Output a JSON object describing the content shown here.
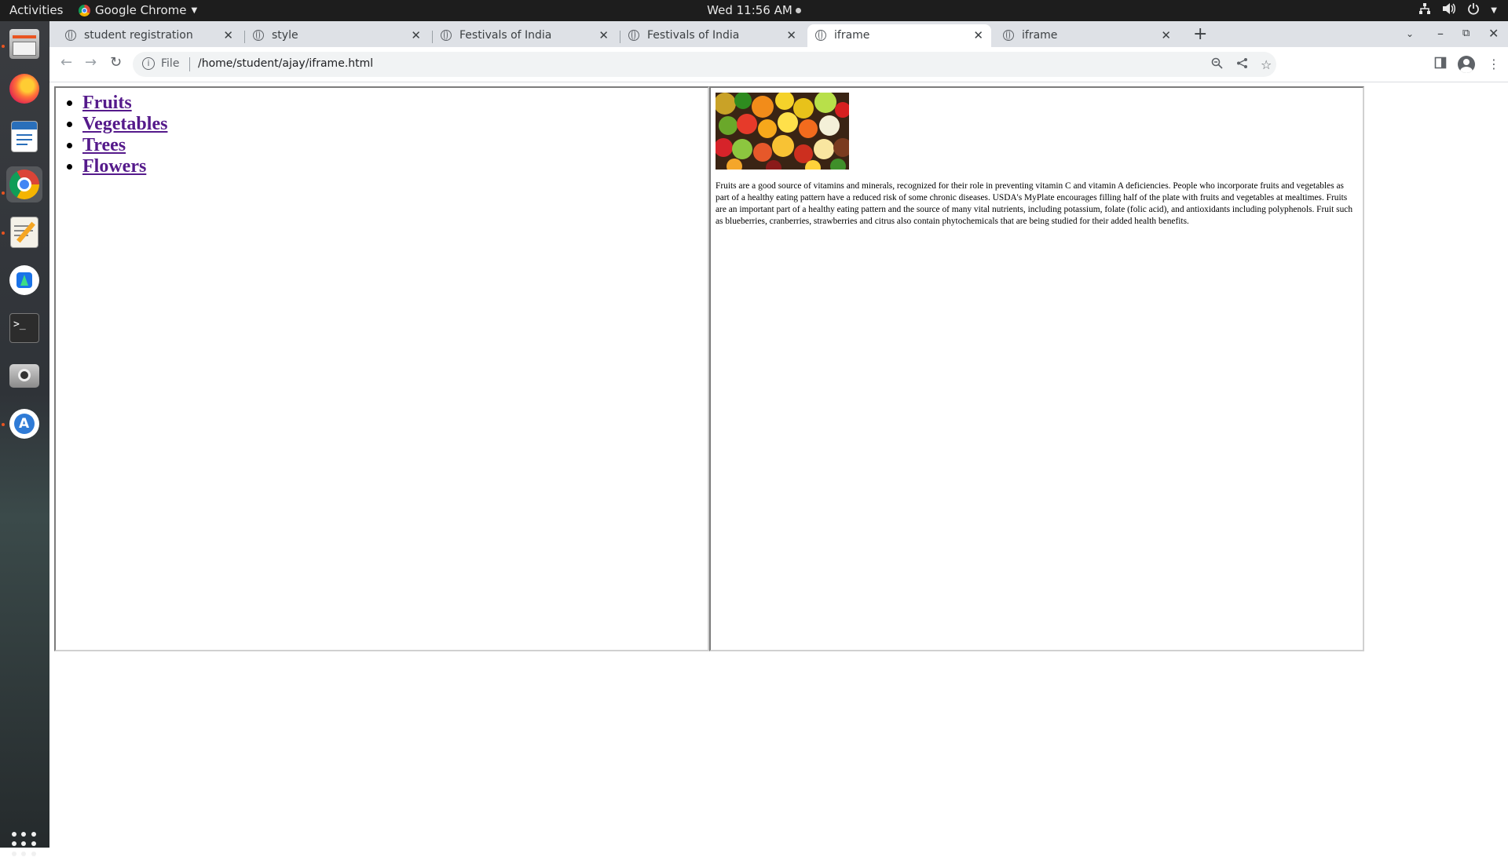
{
  "topbar": {
    "activities": "Activities",
    "app_name": "Google Chrome",
    "clock": "Wed 11:56 AM"
  },
  "dock": {
    "items": [
      "files-icon",
      "firefox-icon",
      "writer-icon",
      "chrome-icon",
      "text-editor-icon",
      "android-studio-icon",
      "terminal-icon",
      "camera-icon",
      "app-center-icon"
    ],
    "show_apps": "apps-grid-icon"
  },
  "browser": {
    "tabs": [
      {
        "label": "student registration",
        "active": false
      },
      {
        "label": "style",
        "active": false
      },
      {
        "label": "Festivals of India",
        "active": false
      },
      {
        "label": "Festivals of India",
        "active": false
      },
      {
        "label": "iframe",
        "active": true
      },
      {
        "label": "iframe",
        "active": false
      }
    ],
    "address": {
      "scheme": "File",
      "url": "/home/student/ajay/iframe.html"
    }
  },
  "page": {
    "links": [
      "Fruits",
      "Vegetables",
      "Trees",
      "Flowers"
    ],
    "content_text": "Fruits are a good source of vitamins and minerals, recognized for their role in preventing vitamin C and vitamin A deficiencies. People who incorporate fruits and vegetables as part of a healthy eating pattern have a reduced risk of some chronic diseases. USDA's MyPlate encourages filling half of the plate with fruits and vegetables at mealtimes. Fruits are an important part of a healthy eating pattern and the source of many vital nutrients, including potassium, folate (folic acid), and antioxidants including polyphenols. Fruit such as blueberries, cranberries, strawberries and citrus also contain phytochemicals that are being studied for their added health benefits."
  }
}
